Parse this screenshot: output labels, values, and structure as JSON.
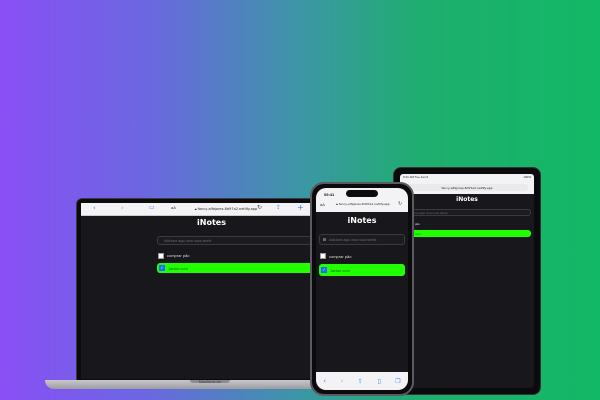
{
  "app": {
    "title": "iNotes",
    "url": "fancy-alfajores-8d97a2.netlify.app",
    "url_short": "fancy-alfajores-8d97a2.netlify.app",
    "reader_label": "aA",
    "placeholder": "Adicione aqui uma nova tarefa",
    "tasks": [
      {
        "label": "comprar pão",
        "done": false
      },
      {
        "label": "Jantar com",
        "done": true
      }
    ]
  },
  "laptop": {
    "brand_label": "MacBook Air"
  },
  "phone": {
    "status_time": "09:41"
  },
  "tablet": {
    "status_left": "9:41 AM Tue Jan 9",
    "status_right": "100%"
  },
  "colors": {
    "bg_start": "#8a4ff5",
    "bg_end": "#12b865",
    "app_bg": "#18181c",
    "done_task": "#22ff00",
    "accent": "#1e6cff"
  }
}
